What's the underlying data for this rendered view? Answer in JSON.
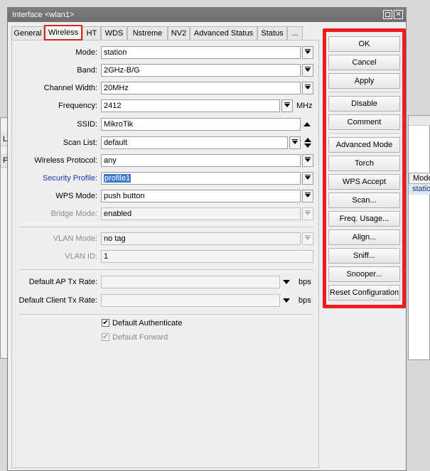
{
  "window": {
    "title": "Interface <wlan1>"
  },
  "background": {
    "left_strip_1": "Li",
    "left_strip_2": "F",
    "right_header": "Mode",
    "right_cell": "station"
  },
  "tabs": [
    "General",
    "Wireless",
    "HT",
    "WDS",
    "Nstreme",
    "NV2",
    "Advanced Status",
    "Status",
    "..."
  ],
  "active_tab": "Wireless",
  "fields": {
    "mode": {
      "label": "Mode:",
      "value": "station"
    },
    "band": {
      "label": "Band:",
      "value": "2GHz-B/G"
    },
    "channel_width": {
      "label": "Channel Width:",
      "value": "20MHz"
    },
    "frequency": {
      "label": "Frequency:",
      "value": "2412",
      "unit": "MHz"
    },
    "ssid": {
      "label": "SSID:",
      "value": "MikroTik"
    },
    "scan_list": {
      "label": "Scan List:",
      "value": "default"
    },
    "wireless_protocol": {
      "label": "Wireless Protocol:",
      "value": "any"
    },
    "security_profile": {
      "label": "Security Profile:",
      "value": "profile1"
    },
    "wps_mode": {
      "label": "WPS Mode:",
      "value": "push button"
    },
    "bridge_mode": {
      "label": "Bridge Mode:",
      "value": "enabled"
    },
    "vlan_mode": {
      "label": "VLAN Mode:",
      "value": "no tag"
    },
    "vlan_id": {
      "label": "VLAN ID:",
      "value": "1"
    },
    "default_ap_tx_rate": {
      "label": "Default AP Tx Rate:",
      "value": "",
      "unit": "bps"
    },
    "default_client_tx_rate": {
      "label": "Default Client Tx Rate:",
      "value": "",
      "unit": "bps"
    }
  },
  "checkboxes": {
    "default_authenticate": {
      "label": "Default Authenticate",
      "checked": true,
      "mark": "✔"
    },
    "default_forward": {
      "label": "Default Forward",
      "checked": true,
      "mark": "✔"
    }
  },
  "buttons": {
    "ok": "OK",
    "cancel": "Cancel",
    "apply": "Apply",
    "disable": "Disable",
    "comment": "Comment",
    "advanced_mode": "Advanced Mode",
    "torch": "Torch",
    "wps_accept": "WPS Accept",
    "scan": "Scan...",
    "freq_usage": "Freq. Usage...",
    "align": "Align...",
    "sniff": "Sniff...",
    "snooper": "Snooper...",
    "reset_configuration": "Reset Configuration"
  },
  "colors": {
    "highlight_border": "#ee1c1c",
    "selection": "#3b78d8",
    "security_label": "#1f35a8"
  }
}
